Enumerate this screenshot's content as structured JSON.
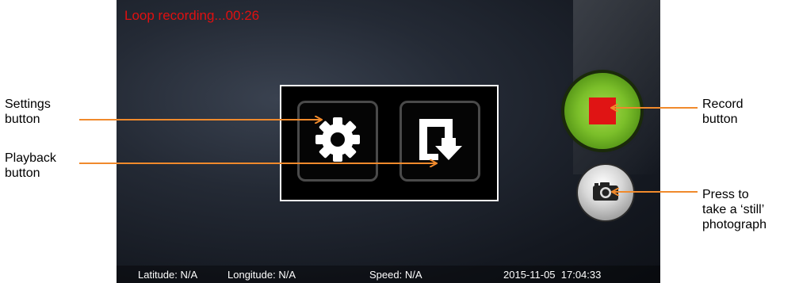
{
  "status": {
    "recording_text": "Loop recording...00:26"
  },
  "statusbar": {
    "latitude": "Latitude: N/A",
    "longitude": "Longitude: N/A",
    "speed": "Speed: N/A",
    "datetime": "2015-11-05  17:04:33"
  },
  "callouts": {
    "settings_line1": "Settings",
    "settings_line2": "button",
    "playback_line1": "Playback",
    "playback_line2": "button",
    "record_line1": "Record",
    "record_line2": "button",
    "still_line1": "Press to",
    "still_line2": "take a ‘still’",
    "still_line3": "photograph"
  },
  "icons": {
    "settings": "gear-icon",
    "playback": "playback-icon",
    "record": "stop-square-icon",
    "still": "camera-icon"
  },
  "colors": {
    "recording_text": "#e01010",
    "callout_arrow": "#f08a2c",
    "record_button": "#7bbf2a",
    "record_square": "#e01414"
  }
}
